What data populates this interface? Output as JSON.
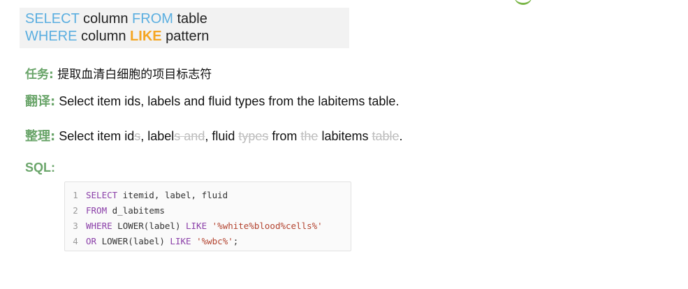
{
  "syntax": {
    "line1": {
      "kw1": "SELECT",
      "t1": " column ",
      "kw2": "FROM",
      "t2": " table"
    },
    "line2": {
      "kw1": "WHERE",
      "t1": " column ",
      "kw2": "LIKE",
      "t2": " pattern"
    }
  },
  "task": {
    "label": "任务:",
    "text": " 提取血清白细胞的项目标志符"
  },
  "translate": {
    "label": "翻译:",
    "text": " Select item ids, labels and fluid types from the labitems table."
  },
  "tidy": {
    "label": "整理:",
    "p1": " Select item id",
    "p1x": "s",
    "p2": ", label",
    "p2x": "s and",
    "p3": ", fluid ",
    "p3x": "types",
    "p4": " from ",
    "p4x": "the",
    "p5": " labitems ",
    "p5x": "table",
    "p6": "."
  },
  "sql_heading": "SQL:",
  "code": {
    "lines": [
      {
        "n": "1",
        "kw": "SELECT",
        "rest": " itemid, label, fluid"
      },
      {
        "n": "2",
        "kw": "FROM",
        "rest": " d_labitems"
      },
      {
        "n": "3",
        "kw": "WHERE",
        "mid": " LOWER(label) ",
        "kw2": "LIKE",
        "sp": " ",
        "str": "'%white%blood%cells%'"
      },
      {
        "n": "4",
        "kw": "OR",
        "mid": " LOWER(label) ",
        "kw2": "LIKE",
        "sp": " ",
        "str": "'%wbc%'",
        "end": ";"
      }
    ]
  }
}
